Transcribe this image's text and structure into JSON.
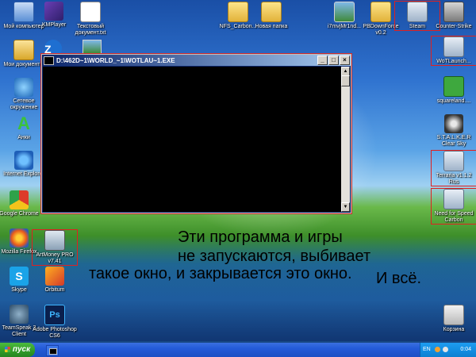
{
  "desktop": {
    "icons": [
      {
        "label": "Мой компьютер"
      },
      {
        "label": "Мои документы"
      },
      {
        "label": "Сетевое окружение"
      },
      {
        "label": "Анки"
      },
      {
        "label": "Internet Explorer"
      },
      {
        "label": "Google Chrome"
      },
      {
        "label": "Mozilla Firefox"
      },
      {
        "label": "Skype"
      },
      {
        "label": "TeamSpeak 3 Client"
      },
      {
        "label": "KMPlayer"
      },
      {
        "label": "Текстовый документ.txt"
      },
      {
        "label": "NFS_Carbon..."
      },
      {
        "label": "Новая папка"
      },
      {
        "label": "i7mvjMr1nd..."
      },
      {
        "label": "PBDownForce v0.2"
      },
      {
        "label": "Steam"
      },
      {
        "label": "Counter-Strike"
      },
      {
        "label": "WoTLaunch..."
      },
      {
        "label": "squareland...."
      },
      {
        "label": "S.T.A.L.K.E.R Clear Sky"
      },
      {
        "label": "Terraria v1.1.2 Rus"
      },
      {
        "label": "Need for Speed Carbon"
      },
      {
        "label": "ArtMoney PRO v7.41"
      },
      {
        "label": "Orbitum"
      },
      {
        "label": "Adobe Photoshop CS6"
      },
      {
        "label": "Корзина"
      }
    ]
  },
  "console_window": {
    "title": "D:\\462D~1\\WORLD_~1\\WOTLAU~1.EXE",
    "minimize_label": "_",
    "maximize_label": "□",
    "close_label": "×",
    "scroll_up": "▲",
    "scroll_down": "▼"
  },
  "caption": {
    "line1": "Эти программа и игры",
    "line2": "не запускаются, выбивает",
    "line3": "такое окно, и закрывается это окно.",
    "line4": "И всё."
  },
  "taskbar": {
    "start_label": "пуск",
    "language": "EN",
    "clock": "0:04"
  }
}
